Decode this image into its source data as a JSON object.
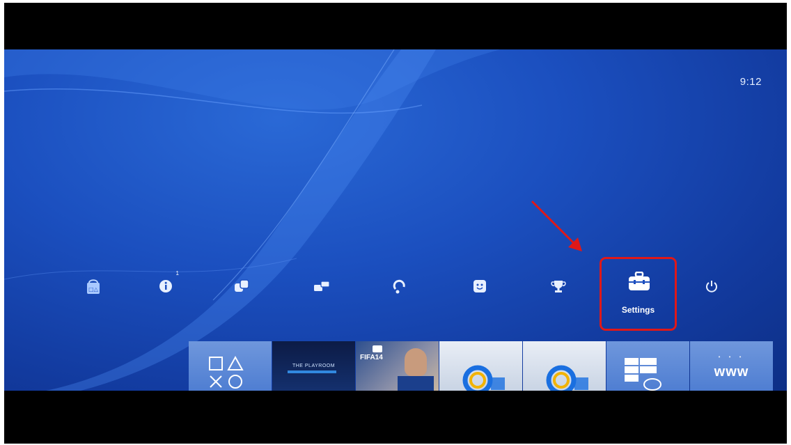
{
  "status": {
    "clock": "9:12"
  },
  "function_bar": {
    "items": [
      {
        "name": "playstation-store",
        "icon": "store-bag-icon"
      },
      {
        "name": "whats-new",
        "icon": "info-icon",
        "badge": "1"
      },
      {
        "name": "friends",
        "icon": "friends-icon"
      },
      {
        "name": "messages",
        "icon": "messages-icon"
      },
      {
        "name": "party",
        "icon": "party-icon"
      },
      {
        "name": "profile",
        "icon": "profile-icon"
      },
      {
        "name": "trophies",
        "icon": "trophy-icon"
      },
      {
        "name": "settings",
        "icon": "toolbox-icon",
        "label": "Settings",
        "selected": true
      },
      {
        "name": "power",
        "icon": "power-icon"
      }
    ]
  },
  "content_row": {
    "tiles": [
      {
        "name": "ps-shapes",
        "label": ""
      },
      {
        "name": "the-playroom",
        "label": "THE PLAYROOM"
      },
      {
        "name": "fifa-14",
        "label": "FIFA14"
      },
      {
        "name": "app-4",
        "label": ""
      },
      {
        "name": "app-5",
        "label": ""
      },
      {
        "name": "tv-video",
        "label": ""
      },
      {
        "name": "internet-browser",
        "label": "www"
      }
    ]
  },
  "annotation": {
    "arrow_color": "#e01818",
    "highlight_color": "#e01818"
  }
}
